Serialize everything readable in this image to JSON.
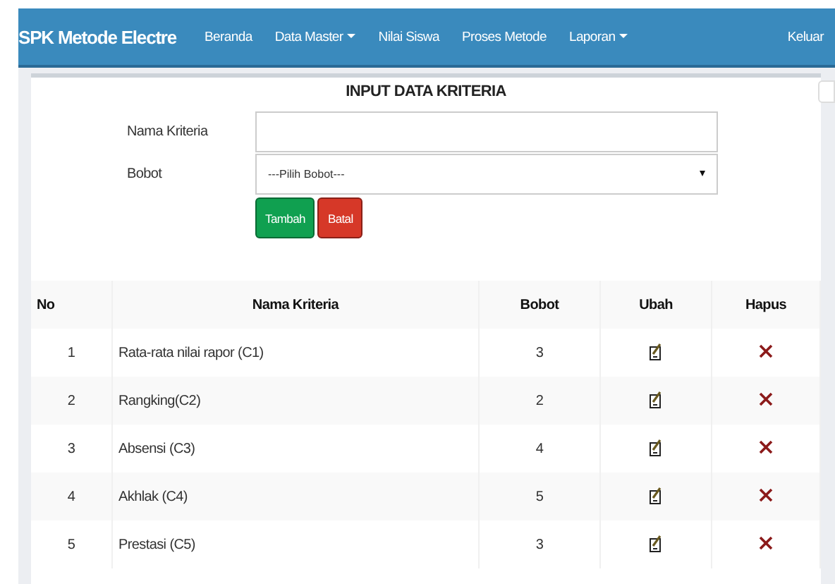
{
  "navbar": {
    "brand": "SPK Metode Electre",
    "items": [
      {
        "label": "Beranda",
        "dropdown": false
      },
      {
        "label": "Data Master",
        "dropdown": true
      },
      {
        "label": "Nilai Siswa",
        "dropdown": false
      },
      {
        "label": "Proses Metode",
        "dropdown": false
      },
      {
        "label": "Laporan",
        "dropdown": true
      }
    ],
    "logout": "Keluar"
  },
  "form": {
    "title": "INPUT DATA KRITERIA",
    "fields": [
      {
        "label": "Nama Kriteria",
        "kind": "text"
      },
      {
        "label": "Bobot",
        "kind": "select",
        "value": "---Pilih Bobot---"
      }
    ],
    "buttons": [
      {
        "label": "Tambah",
        "kind": "primary"
      },
      {
        "label": "Batal",
        "kind": "cancel"
      }
    ]
  },
  "table": {
    "columns": [
      "No",
      "Nama Kriteria",
      "Bobot",
      "Ubah",
      "Hapus"
    ],
    "rows": [
      {
        "no": "1",
        "name": "Rata-rata nilai rapor (C1)",
        "bobot": "3"
      },
      {
        "no": "2",
        "name": "Rangking(C2)",
        "bobot": "2"
      },
      {
        "no": "3",
        "name": "Absensi (C3)",
        "bobot": "4"
      },
      {
        "no": "4",
        "name": "Akhlak (C4)",
        "bobot": "5"
      },
      {
        "no": "5",
        "name": "Prestasi (C5)",
        "bobot": "3"
      }
    ]
  }
}
